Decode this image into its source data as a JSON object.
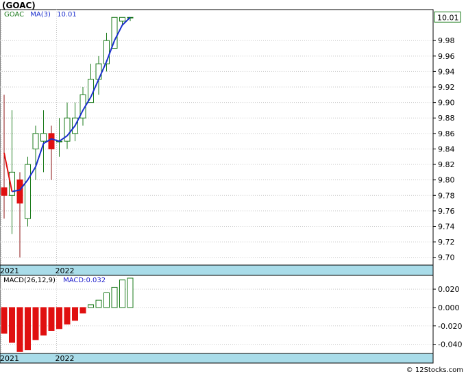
{
  "title": "(GOAC)",
  "copyright": "© 12Stocks.com",
  "colors": {
    "up": "#1a7a1a",
    "down": "#e01010",
    "ma": "#1a2ecc",
    "macd_line": "#2222cc",
    "axis_band": "#a9dce9",
    "grid": "#c8c8c8",
    "ticker": "#1a7a1a"
  },
  "price_legend": {
    "ticker": "GOAC",
    "ma_label": "MA(3)",
    "ma_value": "10.01"
  },
  "last_price_label": "10.01",
  "macd_legend": {
    "params": "MACD(26,12,9)",
    "value_label": "MACD:0.032"
  },
  "chart_data": [
    {
      "type": "candlestick",
      "ylim": [
        9.69,
        10.02
      ],
      "y_ticks": [
        "9.70",
        "9.72",
        "9.74",
        "9.76",
        "9.78",
        "9.80",
        "9.82",
        "9.84",
        "9.86",
        "9.88",
        "9.90",
        "9.92",
        "9.94",
        "9.96",
        "9.98"
      ],
      "x_labels": [
        {
          "label": "2021",
          "index": 0
        },
        {
          "label": "2022",
          "index": 7
        }
      ],
      "candles": [
        {
          "o": 9.79,
          "h": 9.91,
          "l": 9.75,
          "c": 9.78
        },
        {
          "o": 9.78,
          "h": 9.89,
          "l": 9.73,
          "c": 9.81
        },
        {
          "o": 9.8,
          "h": 9.81,
          "l": 9.7,
          "c": 9.77
        },
        {
          "o": 9.75,
          "h": 9.83,
          "l": 9.74,
          "c": 9.82
        },
        {
          "o": 9.84,
          "h": 9.87,
          "l": 9.8,
          "c": 9.86
        },
        {
          "o": 9.85,
          "h": 9.89,
          "l": 9.81,
          "c": 9.86
        },
        {
          "o": 9.86,
          "h": 9.87,
          "l": 9.8,
          "c": 9.84
        },
        {
          "o": 9.85,
          "h": 9.88,
          "l": 9.83,
          "c": 9.85
        },
        {
          "o": 9.85,
          "h": 9.9,
          "l": 9.84,
          "c": 9.88
        },
        {
          "o": 9.86,
          "h": 9.9,
          "l": 9.85,
          "c": 9.88
        },
        {
          "o": 9.88,
          "h": 9.92,
          "l": 9.87,
          "c": 9.91
        },
        {
          "o": 9.9,
          "h": 9.95,
          "l": 9.9,
          "c": 9.93
        },
        {
          "o": 9.93,
          "h": 9.96,
          "l": 9.91,
          "c": 9.95
        },
        {
          "o": 9.95,
          "h": 9.99,
          "l": 9.94,
          "c": 9.98
        },
        {
          "o": 9.97,
          "h": 10.01,
          "l": 9.97,
          "c": 10.01
        },
        {
          "o": 10.005,
          "h": 10.01,
          "l": 10.0,
          "c": 10.01
        },
        {
          "o": 10.01,
          "h": 10.01,
          "l": 10.005,
          "c": 10.01
        }
      ],
      "ma3": [
        9.835,
        9.785,
        9.787,
        9.8,
        9.817,
        9.847,
        9.853,
        9.85,
        9.857,
        9.87,
        9.89,
        9.907,
        9.93,
        9.953,
        9.98,
        10.0,
        10.01
      ]
    },
    {
      "type": "bar",
      "title": "MACD(26,12,9)",
      "ylim": [
        -0.05,
        0.035
      ],
      "y_ticks": [
        "0.020",
        "0.000",
        "-0.020",
        "-0.040"
      ],
      "x_labels": [
        {
          "label": "2021",
          "index": 0
        },
        {
          "label": "2022",
          "index": 7
        }
      ],
      "values": [
        -0.028,
        -0.038,
        -0.048,
        -0.046,
        -0.035,
        -0.03,
        -0.025,
        -0.023,
        -0.018,
        -0.014,
        -0.006,
        0.003,
        0.008,
        0.016,
        0.022,
        0.03,
        0.032
      ]
    }
  ]
}
